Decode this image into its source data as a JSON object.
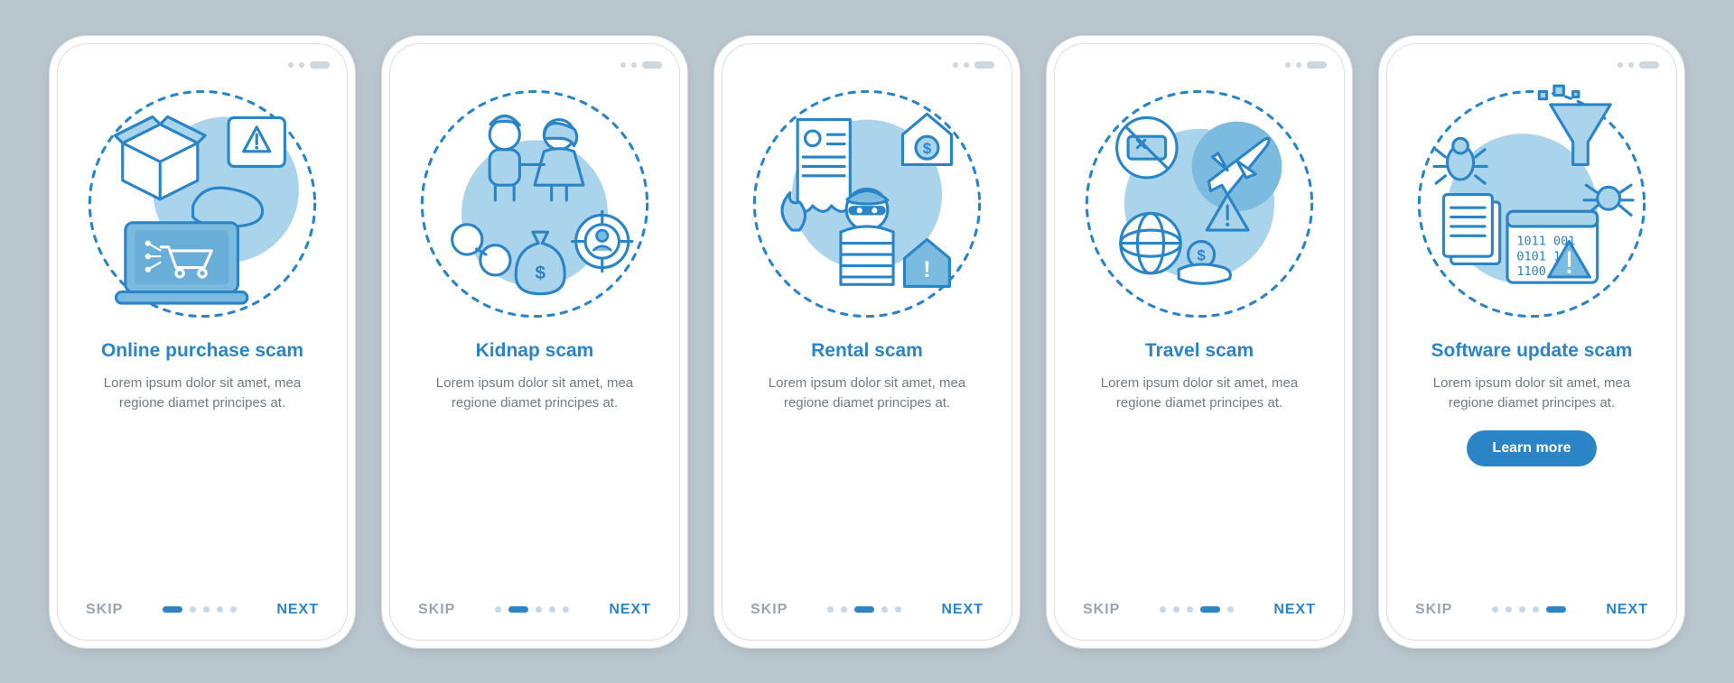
{
  "common": {
    "skip_label": "SKIP",
    "next_label": "NEXT",
    "description": "Lorem ipsum dolor sit amet, mea regione diamet principes at.",
    "learn_more_label": "Learn more",
    "total_steps": 5
  },
  "screens": [
    {
      "id": "online-purchase",
      "title": "Online purchase scam",
      "illustration": "online-purchase-icon",
      "has_learn_more": false,
      "active_index": 0
    },
    {
      "id": "kidnap",
      "title": "Kidnap scam",
      "illustration": "kidnap-icon",
      "has_learn_more": false,
      "active_index": 1
    },
    {
      "id": "rental",
      "title": "Rental scam",
      "illustration": "rental-icon",
      "has_learn_more": false,
      "active_index": 2
    },
    {
      "id": "travel",
      "title": "Travel scam",
      "illustration": "travel-icon",
      "has_learn_more": false,
      "active_index": 3
    },
    {
      "id": "software-update",
      "title": "Software update scam",
      "illustration": "software-update-icon",
      "has_learn_more": true,
      "active_index": 4
    }
  ]
}
